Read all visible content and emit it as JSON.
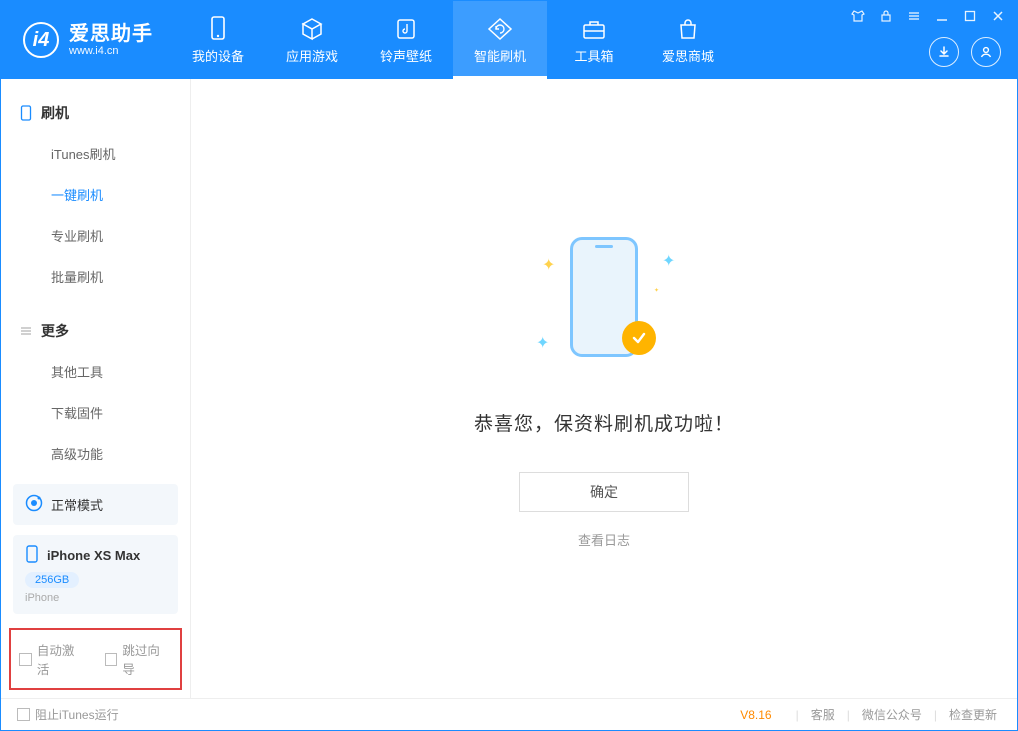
{
  "app": {
    "title": "爱思助手",
    "subtitle": "www.i4.cn"
  },
  "nav": {
    "items": [
      {
        "label": "我的设备",
        "icon": "phone-icon"
      },
      {
        "label": "应用游戏",
        "icon": "cube-icon"
      },
      {
        "label": "铃声壁纸",
        "icon": "music-note-icon"
      },
      {
        "label": "智能刷机",
        "icon": "refresh-icon",
        "active": true
      },
      {
        "label": "工具箱",
        "icon": "toolbox-icon"
      },
      {
        "label": "爱思商城",
        "icon": "bag-icon"
      }
    ]
  },
  "sidebar": {
    "section1": {
      "title": "刷机",
      "items": [
        {
          "label": "iTunes刷机"
        },
        {
          "label": "一键刷机",
          "selected": true
        },
        {
          "label": "专业刷机"
        },
        {
          "label": "批量刷机"
        }
      ]
    },
    "section2": {
      "title": "更多",
      "items": [
        {
          "label": "其他工具"
        },
        {
          "label": "下载固件"
        },
        {
          "label": "高级功能"
        }
      ]
    },
    "status": {
      "label": "正常模式"
    },
    "device": {
      "name": "iPhone XS Max",
      "storage": "256GB",
      "type": "iPhone"
    },
    "checkboxes": {
      "auto_activate": "自动激活",
      "skip_guide": "跳过向导"
    }
  },
  "main": {
    "success_text": "恭喜您，保资料刷机成功啦！",
    "ok_button": "确定",
    "view_log": "查看日志"
  },
  "footer": {
    "block_itunes": "阻止iTunes运行",
    "version": "V8.16",
    "links": {
      "support": "客服",
      "wechat": "微信公众号",
      "update": "检查更新"
    }
  }
}
